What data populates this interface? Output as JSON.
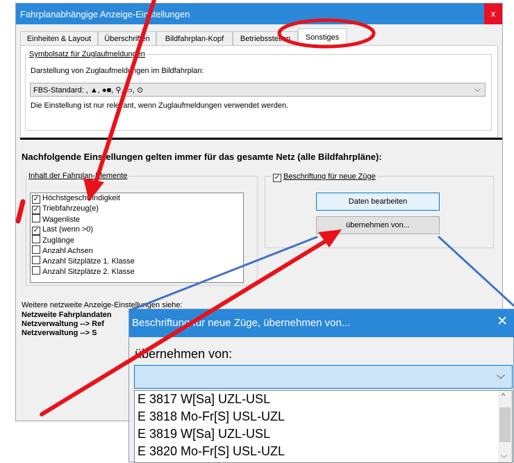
{
  "dialog": {
    "title": "Fahrplanabhängige Anzeige-Einstellungen",
    "close_label": "x",
    "tabs": [
      "Einheiten & Layout",
      "Überschriften",
      "Bildfahrplan-Kopf",
      "Betriebsstellen",
      "Sonstiges"
    ],
    "active_tab": "Sonstiges"
  },
  "symbol_group": {
    "title": "Symbolsatz für Zuglaufmeldungen",
    "label": "Darstellung von Zuglaufmeldungen im Bildfahrplan:",
    "combo_value": "FBS-Standard: , ▲, ●■, ⚲, ▭, ⊙",
    "note": "Die Einstellung ist nur relevant, wenn Zuglaufmeldungen verwendet werden."
  },
  "heading": "Nachfolgende Einstellungen gelten immer für das gesamte Netz (alle Bildfahrpläne):",
  "content_group": {
    "title": "Inhalt der Fahrplan-Elemente",
    "items": [
      {
        "label": "Höchstgeschwindigkeit",
        "mark": "✓"
      },
      {
        "label": "Triebfahrzeug(e)",
        "mark": "✓"
      },
      {
        "label": "Wagenliste",
        "mark": ""
      },
      {
        "label": "Last (wenn >0)",
        "mark": "✓"
      },
      {
        "label": "Zuglänge",
        "mark": ""
      },
      {
        "label": "Anzahl Achsen",
        "mark": ""
      },
      {
        "label": "Anzahl Sitzplätze 1. Klasse",
        "mark": ""
      },
      {
        "label": "Anzahl Sitzplätze 2. Klasse",
        "mark": ""
      }
    ]
  },
  "label_group": {
    "title": "Beschriftung für neue Züge",
    "mark": "✓",
    "btn_daten": "Daten bearbeiten",
    "btn_uebernehmen": "übernehmen von..."
  },
  "footer": {
    "line1": "Weitere netzweite Anzeige-Einstellungen siehe:",
    "line2": "Netzweite Fahrplandaten",
    "line3": "Netzverwaltung --> Ref",
    "line4": "Netzverwaltung --> S"
  },
  "popup": {
    "title": "Beschriftung für neue Züge, übernehmen von...",
    "close": "✕",
    "label": "übernehmen von:",
    "combo_value": "",
    "rows": [
      "E 3817 W[Sa] UZL-USL",
      "E 3818 Mo-Fr[S] USL-UZL",
      "E 3819 W[Sa] UZL-USL",
      "E 3820 Mo-Fr[S] USL-UZL"
    ]
  },
  "colors": {
    "titlebar": "#2b88d8",
    "close": "#e81123",
    "annotation": "#e8121a",
    "connector": "#4472c4"
  }
}
